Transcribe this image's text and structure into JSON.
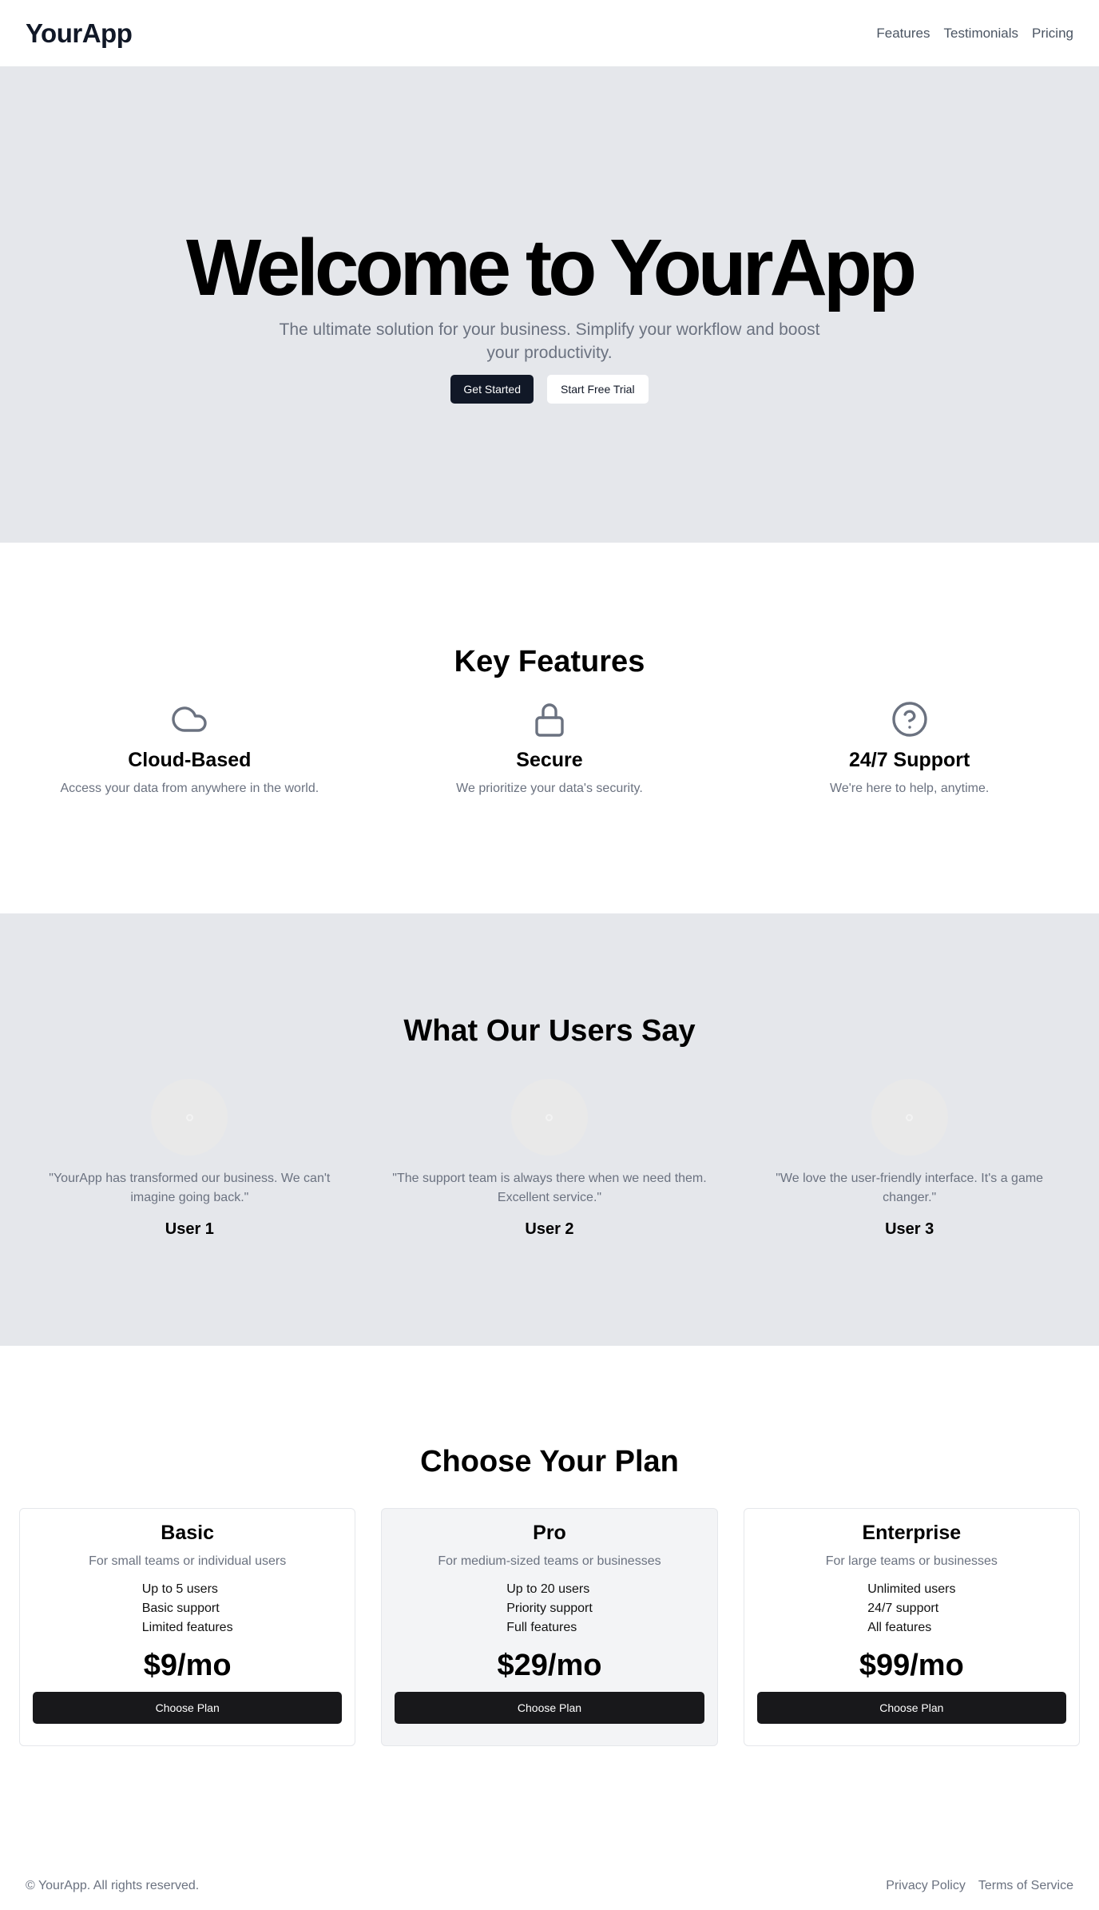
{
  "header": {
    "brand": "YourApp",
    "nav": [
      "Features",
      "Testimonials",
      "Pricing"
    ]
  },
  "hero": {
    "title": "Welcome to YourApp",
    "subtitle": "The ultimate solution for your business. Simplify your workflow and boost your productivity.",
    "primary_cta": "Get Started",
    "secondary_cta": "Start Free Trial"
  },
  "features": {
    "title": "Key Features",
    "items": [
      {
        "icon": "cloud-icon",
        "title": "Cloud-Based",
        "text": "Access your data from anywhere in the world."
      },
      {
        "icon": "lock-icon",
        "title": "Secure",
        "text": "We prioritize your data's security."
      },
      {
        "icon": "help-circle-icon",
        "title": "24/7 Support",
        "text": "We're here to help, anytime."
      }
    ]
  },
  "testimonials": {
    "title": "What Our Users Say",
    "items": [
      {
        "quote": "\"YourApp has transformed our business. We can't imagine going back.\"",
        "name": "User 1"
      },
      {
        "quote": "\"The support team is always there when we need them. Excellent service.\"",
        "name": "User 2"
      },
      {
        "quote": "\"We love the user-friendly interface. It's a game changer.\"",
        "name": "User 3"
      }
    ]
  },
  "pricing": {
    "title": "Choose Your Plan",
    "plans": [
      {
        "name": "Basic",
        "desc": "For small teams or individual users",
        "features": [
          "Up to 5 users",
          "Basic support",
          "Limited features"
        ],
        "price": "$9/mo",
        "cta": "Choose Plan"
      },
      {
        "name": "Pro",
        "desc": "For medium-sized teams or businesses",
        "features": [
          "Up to 20 users",
          "Priority support",
          "Full features"
        ],
        "price": "$29/mo",
        "cta": "Choose Plan"
      },
      {
        "name": "Enterprise",
        "desc": "For large teams or businesses",
        "features": [
          "Unlimited users",
          "24/7 support",
          "All features"
        ],
        "price": "$99/mo",
        "cta": "Choose Plan"
      }
    ]
  },
  "footer": {
    "copyright": "© YourApp. All rights reserved.",
    "links": [
      "Privacy Policy",
      "Terms of Service"
    ]
  },
  "colors": {
    "primary_button": "#111827",
    "section_gray": "#e5e7eb",
    "muted_text": "#6b7280"
  }
}
